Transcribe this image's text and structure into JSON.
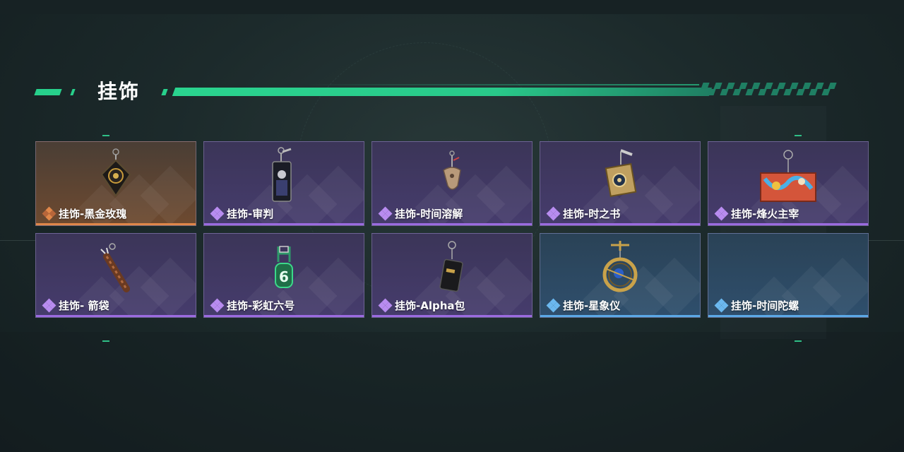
{
  "section": {
    "title": "挂饰"
  },
  "cards": [
    {
      "label": "挂饰-黑金玫瑰",
      "rarity": "orange",
      "icon": "black-gold-rose-charm-icon"
    },
    {
      "label": "挂饰-审判",
      "rarity": "purple",
      "icon": "judgement-card-charm-icon"
    },
    {
      "label": "挂饰-时间溶解",
      "rarity": "purple",
      "icon": "melting-clock-charm-icon"
    },
    {
      "label": "挂饰-时之书",
      "rarity": "purple",
      "icon": "book-of-time-charm-icon"
    },
    {
      "label": "挂饰-烽火主宰",
      "rarity": "purple",
      "icon": "graffiti-container-charm-icon"
    },
    {
      "label": "挂饰- 箭袋",
      "rarity": "purple",
      "icon": "quiver-charm-icon"
    },
    {
      "label": "挂饰-彩虹六号",
      "rarity": "purple",
      "icon": "rainbow-six-charm-icon"
    },
    {
      "label": "挂饰-Alpha包",
      "rarity": "purple",
      "icon": "alpha-pouch-charm-icon"
    },
    {
      "label": "挂饰-星象仪",
      "rarity": "blue",
      "icon": "astrolabe-charm-icon"
    },
    {
      "label": "挂饰-时间陀螺",
      "rarity": "blue",
      "icon": "time-gyro-charm-icon"
    }
  ],
  "colors": {
    "accent": "#27d08b",
    "purple": "#9b6be0",
    "blue": "#5ba8e6",
    "orange": "#e0874a"
  }
}
